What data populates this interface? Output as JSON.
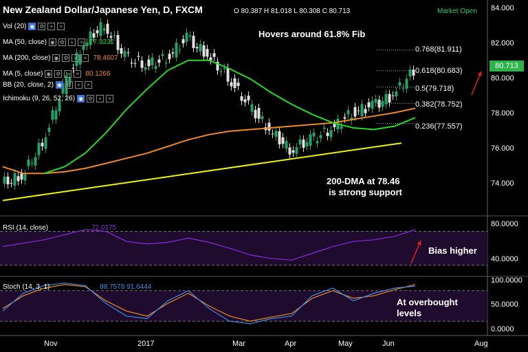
{
  "header": {
    "title": "New Zealand Dollar/Japanese Yen, D, FXCM",
    "ohlc": "O 80.387  H 81.018  L 80.308  C 80.713",
    "market_status": "Market Open"
  },
  "indicators": [
    {
      "label": "Vol (20)",
      "value": "",
      "color": "#ffffff"
    },
    {
      "label": "MA (50, close)",
      "value": "77.9232",
      "color": "#22dd22"
    },
    {
      "label": "MA (200, close)",
      "value": "78.4607",
      "color": "#f08a24"
    },
    {
      "label": "MA (5, close)",
      "value": "80.1266",
      "color": "#f08a24"
    },
    {
      "label": "BB (20, close, 2)",
      "value": "",
      "color": "#ffffff"
    },
    {
      "label": "Ichimoku (9, 26, 52, 26)",
      "value": "",
      "color": "#ffffff"
    }
  ],
  "price_badge": "80.713",
  "annotations": {
    "fib_note": "Hovers around 61.8% Fib",
    "support_note_line1": "200-DMA at 78.46",
    "support_note_line2": "is strong support",
    "rsi_note": "Bias higher",
    "stoch_note_line1": "At overbought",
    "stoch_note_line2": "levels"
  },
  "colors": {
    "up": "#26a269",
    "down": "#e0e0e0",
    "ma50": "#22dd22",
    "ma200": "#f08a24",
    "trendline": "#f5f500",
    "rsi": "#8a2be2",
    "stoch_k": "#3b8fe8",
    "stoch_d": "#f08a24",
    "arrow": "#e02020",
    "osc_band": "#1e0b2e"
  },
  "chart_data": [
    {
      "type": "line",
      "panel": "price",
      "title": "New Zealand Dollar/Japanese Yen, D, FXCM",
      "x_ticks": [
        "Nov",
        "2017",
        "Mar",
        "Apr",
        "May",
        "Jun",
        "Aug"
      ],
      "y_ticks": [
        "84.000",
        "82.000",
        "80.000",
        "78.000",
        "76.000",
        "74.000"
      ],
      "ylim": [
        72.7,
        84.3
      ],
      "x_dates": [
        "Oct 10",
        "Oct 25",
        "Nov 5",
        "Nov 20",
        "Dec 5",
        "Dec 15",
        "Dec 22",
        "Jan 5",
        "Jan 20",
        "Feb 1",
        "Feb 15",
        "Mar 1",
        "Mar 15",
        "Apr 1",
        "Apr 10",
        "Apr 20",
        "May 1",
        "May 10",
        "May 20",
        "Jun 1",
        "Jun 9"
      ],
      "series": [
        {
          "role": "close",
          "values": [
            74.0,
            74.4,
            76.4,
            79.6,
            82.3,
            83.4,
            81.5,
            81.0,
            81.4,
            82.6,
            81.6,
            80.3,
            78.6,
            77.2,
            76.0,
            76.6,
            77.2,
            78.2,
            78.6,
            79.2,
            80.7
          ]
        },
        {
          "role": "MA 50",
          "values": [
            null,
            null,
            74.6,
            75.0,
            75.8,
            77.0,
            78.4,
            79.6,
            80.7,
            81.3,
            81.3,
            80.8,
            80.2,
            79.4,
            78.7,
            78.1,
            77.6,
            77.3,
            77.2,
            77.4,
            77.9
          ]
        },
        {
          "role": "MA 200",
          "values": [
            75.0,
            74.6,
            74.6,
            74.7,
            74.9,
            75.2,
            75.5,
            75.8,
            76.2,
            76.6,
            76.9,
            77.1,
            77.2,
            77.3,
            77.4,
            77.5,
            77.6,
            77.8,
            78.0,
            78.2,
            78.46
          ]
        }
      ],
      "trendline": {
        "start": [
          "Oct 10",
          73.0
        ],
        "end": [
          "Jun 9",
          76.4
        ]
      },
      "fib_levels": [
        {
          "label": "0.768(81.911)",
          "value": 81.911
        },
        {
          "label": "0.618(80.683)",
          "value": 80.683
        },
        {
          "label": "0.5(79.718)",
          "value": 79.718
        },
        {
          "label": "0.382(78.752)",
          "value": 78.752
        },
        {
          "label": "0.236(77.557)",
          "value": 77.557
        }
      ]
    },
    {
      "type": "line",
      "panel": "rsi",
      "label": "RSI (14, close)",
      "value_text": "72.0175",
      "y_ticks": [
        "80.0000",
        "40.0000"
      ],
      "ylim": [
        20,
        85
      ],
      "band": [
        30,
        70
      ],
      "values": [
        52,
        56,
        60,
        66,
        72,
        70,
        58,
        55,
        57,
        62,
        57,
        50,
        42,
        38,
        36,
        44,
        52,
        58,
        60,
        64,
        72
      ]
    },
    {
      "type": "line",
      "panel": "stoch",
      "label": "Stoch (14, 3, 1)",
      "value_text": "88.7578  91.6444",
      "y_ticks": [
        "100.0000",
        "50.0000",
        "0.0000"
      ],
      "ylim": [
        0,
        100
      ],
      "band": [
        20,
        80
      ],
      "series": [
        {
          "name": "%K",
          "values": [
            40,
            75,
            90,
            95,
            90,
            55,
            30,
            25,
            60,
            80,
            45,
            20,
            15,
            25,
            30,
            70,
            85,
            60,
            75,
            85,
            89
          ]
        },
        {
          "name": "%D",
          "values": [
            45,
            70,
            85,
            92,
            88,
            60,
            40,
            30,
            55,
            75,
            50,
            30,
            20,
            28,
            35,
            65,
            80,
            65,
            70,
            82,
            92
          ]
        }
      ]
    }
  ]
}
